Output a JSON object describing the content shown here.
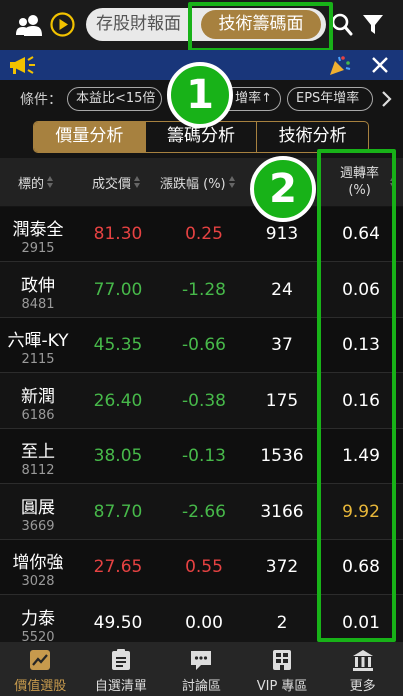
{
  "top_bar": {
    "tab_left": "存股財報面",
    "tab_right": "技術籌碼面"
  },
  "conditions": {
    "label": "條件：",
    "chips": [
      "本益比<15倍",
      "增率↑",
      "EPS年增率"
    ]
  },
  "analysis_tabs": [
    "價量分析",
    "籌碼分析",
    "技術分析"
  ],
  "table": {
    "headers": {
      "symbol": "標的",
      "price": "成交價",
      "change": "漲跌幅 (%)",
      "turnover": "週轉率",
      "turnover_unit": "(%)"
    },
    "rows": [
      {
        "name": "潤泰全",
        "code": "2915",
        "price": "81.30",
        "change": "0.25",
        "volume": "913",
        "turnover": "0.64",
        "dir": "up"
      },
      {
        "name": "政伸",
        "code": "8481",
        "price": "77.00",
        "change": "-1.28",
        "volume": "24",
        "turnover": "0.06",
        "dir": "down"
      },
      {
        "name": "六暉-KY",
        "code": "2115",
        "price": "45.35",
        "change": "-0.66",
        "volume": "37",
        "turnover": "0.13",
        "dir": "down"
      },
      {
        "name": "新潤",
        "code": "6186",
        "price": "26.40",
        "change": "-0.38",
        "volume": "175",
        "turnover": "0.16",
        "dir": "down"
      },
      {
        "name": "至上",
        "code": "8112",
        "price": "38.05",
        "change": "-0.13",
        "volume": "1536",
        "turnover": "1.49",
        "dir": "down"
      },
      {
        "name": "圓展",
        "code": "3669",
        "price": "87.70",
        "change": "-2.66",
        "volume": "3166",
        "turnover": "9.92",
        "dir": "down",
        "turn_warn": true
      },
      {
        "name": "增你強",
        "code": "3028",
        "price": "27.65",
        "change": "0.55",
        "volume": "372",
        "turnover": "0.68",
        "dir": "up"
      },
      {
        "name": "力泰",
        "code": "5520",
        "price": "49.50",
        "change": "0.00",
        "volume": "2",
        "turnover": "0.01",
        "dir": "flat"
      }
    ]
  },
  "badges": {
    "one": "1",
    "two": "2"
  },
  "bottom_nav": [
    {
      "label": "價值選股",
      "icon": "chart-icon",
      "active": true
    },
    {
      "label": "自選清單",
      "icon": "list-icon",
      "active": false
    },
    {
      "label": "討論區",
      "icon": "chat-icon",
      "active": false
    },
    {
      "label": "VIP 專區",
      "icon": "vip-icon",
      "active": false
    },
    {
      "label": "更多",
      "icon": "more-icon",
      "active": false
    }
  ],
  "colors": {
    "accent": "#a7813f",
    "up": "#e64242",
    "down": "#47b94a",
    "highlight": "#18b218",
    "warn": "#e9b83a"
  }
}
